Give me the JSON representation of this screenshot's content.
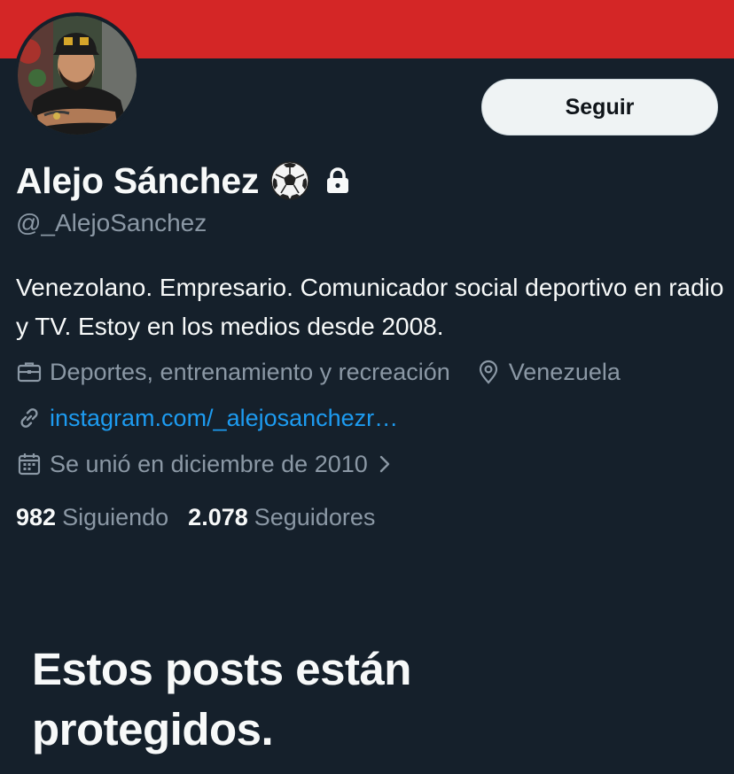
{
  "profile": {
    "display_name": "Alejo Sánchez",
    "handle": "@_AlejoSanchez",
    "bio": "Venezolano. Empresario. Comunicador social deportivo en radio y TV. Estoy en los medios desde 2008.",
    "category": "Deportes, entrenamiento y recreación",
    "location": "Venezuela",
    "website": "instagram.com/_alejosanchezr…",
    "joined": "Se unió en diciembre de 2010",
    "name_emoji": "soccer-ball-icon",
    "protected_icon": "lock-icon"
  },
  "actions": {
    "follow_label": "Seguir"
  },
  "stats": {
    "following_count": "982",
    "following_label": "Siguiendo",
    "followers_count": "2.078",
    "followers_label": "Seguidores"
  },
  "protected_message": {
    "title": "Estos posts están protegidos."
  },
  "colors": {
    "banner": "#d42626",
    "background": "#15202b",
    "text_primary": "#f7f9f9",
    "text_secondary": "#8b98a5",
    "link": "#1d9bf0",
    "button_bg": "#eff3f4",
    "button_text": "#0f1419"
  }
}
